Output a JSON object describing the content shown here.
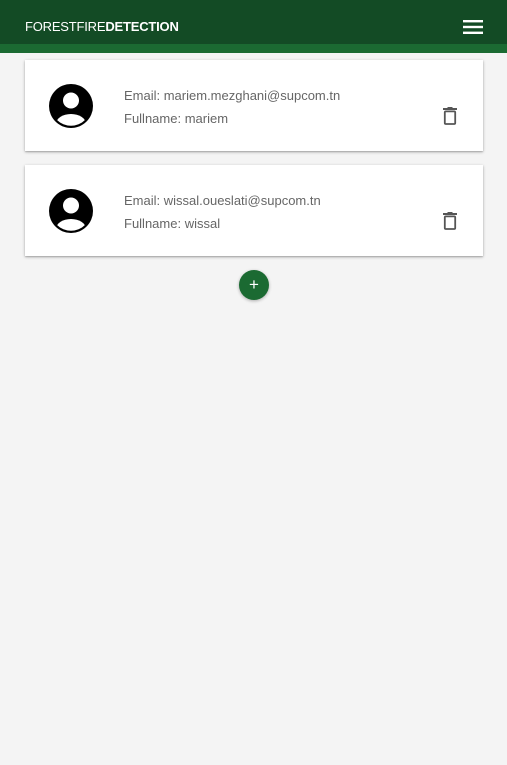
{
  "app": {
    "brand_light": "FORESTFIRE",
    "brand_bold": "DETECTION",
    "menu_icon": "hamburger-menu-icon"
  },
  "colors": {
    "app_bar": "#134b25",
    "app_bar_stripe": "#1b6a32",
    "accent": "#1b6a32",
    "background": "#f4f4f4"
  },
  "users": [
    {
      "email": "Email: mariem.mezghani@supcom.tn",
      "fullname": "Fullname: mariem",
      "avatar_icon": "account-circle-icon",
      "delete_icon": "trash-icon"
    },
    {
      "email": "Email: wissal.oueslati@supcom.tn",
      "fullname": "Fullname: wissal",
      "avatar_icon": "account-circle-icon",
      "delete_icon": "trash-icon"
    }
  ],
  "add_button": {
    "label": "+",
    "icon": "plus-icon"
  }
}
